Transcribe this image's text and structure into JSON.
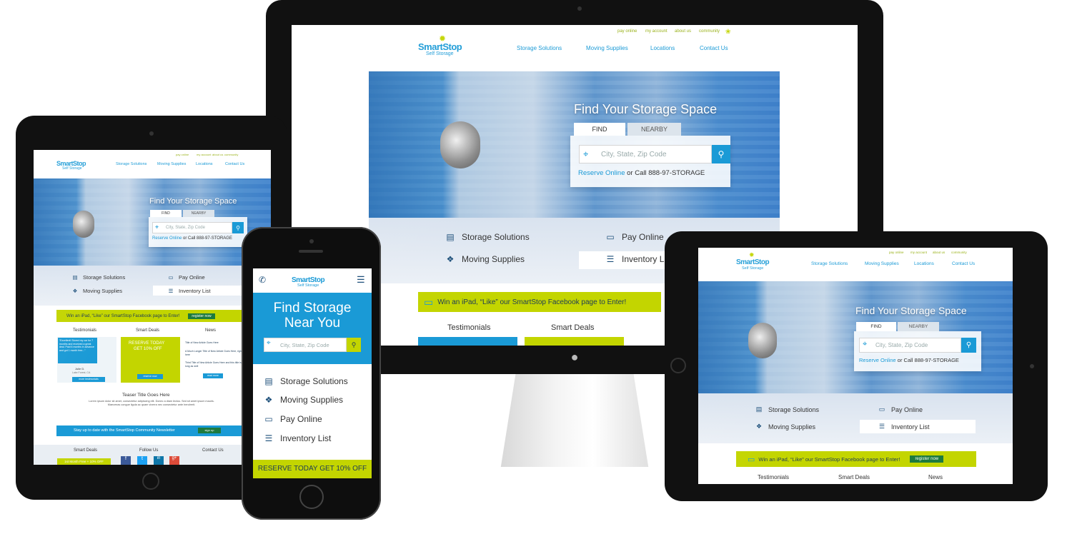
{
  "brand": {
    "name": "SmartStop",
    "sub": "Self Storage"
  },
  "util_links": [
    "pay online",
    "my account",
    "about us",
    "community"
  ],
  "nav": [
    "Storage Solutions",
    "Moving Supplies",
    "Locations",
    "Contact Us"
  ],
  "hero": {
    "title": "Find Your Storage Space",
    "mobile_title_1": "Find Storage",
    "mobile_title_2": "Near You",
    "tab_find": "FIND",
    "tab_nearby": "NEARBY",
    "placeholder": "City, State, Zip Code",
    "reserve_link": "Reserve Online",
    "reserve_or": " or Call ",
    "reserve_phone": "888-97-STORAGE"
  },
  "quick_links": [
    "Storage Solutions",
    "Moving Supplies",
    "Pay Online",
    "Inventory List"
  ],
  "promo": {
    "text": "Win an iPad, “Like” our SmartStop Facebook page to Enter!",
    "button": "register now"
  },
  "columns": [
    "Testimonials",
    "Smart Deals",
    "News"
  ],
  "tablet_extra": {
    "testimonial": "“Excellent! Stored my car for 7 months and received a great deal. Paid 6 months in advance and got 1 month free...”",
    "testimonial_author": "Julie D.",
    "testimonial_loc": "Lake Forest, CA",
    "more_testimonials": "more testimonials",
    "deal_1": "RESERVE TODAY",
    "deal_2": "GET 10% OFF",
    "reserve_now": "reserve now",
    "news_1": "Title of New Article Goes Here",
    "news_2": "A Much Longer Title of New Article Goes Here, right here",
    "news_3": "Third Title of New Article Goes Here and this title is long as well",
    "read_more": "read more",
    "teaser_title": "Teaser Title Goes Here",
    "teaser_text": "Lorem ipsum dolor sit amet, consectetur adipiscing elit. Donec a diam lectus. Sed sit amet ipsum mauris. Maecenas congue ligula ac quam viverra nec consectetur ante hendrerit.",
    "newsletter": "Stay up to date with the SmartStop Community Newsletter",
    "sign_up": "sign up",
    "footer_cols": [
      "Smart Deals",
      "Follow Us",
      "Contact Us"
    ],
    "footer_deal": "1st Month Free + 10% OFF"
  },
  "mobile": {
    "cta": "RESERVE TODAY GET 10% OFF"
  },
  "colors": {
    "blue": "#1a9ad6",
    "lime": "#c3d500",
    "navy": "#1d3b57",
    "green_btn": "#1d7a3e"
  }
}
